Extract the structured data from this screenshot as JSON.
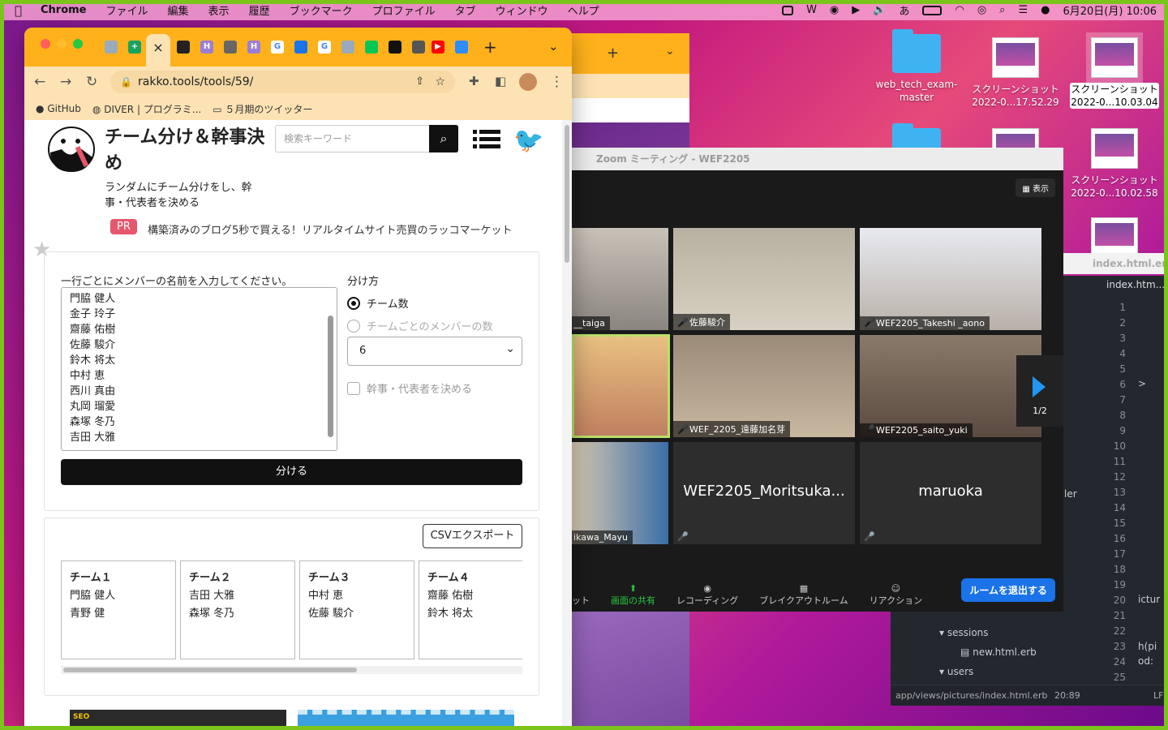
{
  "menubar": {
    "app": "Chrome",
    "items": [
      "ファイル",
      "編集",
      "表示",
      "履歴",
      "ブックマーク",
      "プロファイル",
      "タブ",
      "ウィンドウ",
      "ヘルプ"
    ],
    "ime": "あ",
    "datetime": "6月20日(月)  10:06"
  },
  "desktop": {
    "icons": [
      {
        "label": "web_tech_exam-master"
      },
      {
        "label": "スクリーンショット 2022-0...17.52.29"
      },
      {
        "label": "スクリーンショット 2022-0...10.03.04"
      },
      {
        "label": "スクリーンショット 2022-0...10.02.58"
      }
    ]
  },
  "browser": {
    "url": "rakko.tools/tools/59/",
    "active_tab_icon": "×",
    "bookmarks": [
      "GitHub",
      "DIVER | プログラミ...",
      "５月期のツイッター"
    ]
  },
  "page": {
    "title": "チーム分け＆幹事決め",
    "description": "ランダムにチーム分けをし、幹事・代表者を決める",
    "search_placeholder": "検索キーワード",
    "pr_badge": "PR",
    "pr_text": "構築済みのブログ5秒で買える！リアルタイムサイト売買のラッコマーケット",
    "members_label": "一行ごとにメンバーの名前を入力してください。",
    "members": [
      "門脇 健人",
      "金子 玲子",
      "齋藤 佑樹",
      "佐藤 駿介",
      "鈴木 将太",
      "中村 恵",
      "西川 真由",
      "丸岡 瑠愛",
      "森塚 冬乃",
      "吉田 大雅"
    ],
    "method_label": "分け方",
    "option_teams": "チーム数",
    "option_members": "チームごとのメンバーの数",
    "select_value": "6",
    "leader_checkbox": "幹事・代表者を決める",
    "submit": "分ける",
    "csv_button": "CSVエクスポート",
    "teams": [
      {
        "name": "チーム１",
        "members": [
          "門脇 健人",
          "青野 健"
        ]
      },
      {
        "name": "チーム２",
        "members": [
          "吉田 大雅",
          "森塚 冬乃"
        ]
      },
      {
        "name": "チーム３",
        "members": [
          "中村 恵",
          "佐藤 駿介"
        ]
      },
      {
        "name": "チーム４",
        "members": [
          "齋藤 佑樹",
          "鈴木 将太"
        ]
      }
    ],
    "ad_badge": "SEO"
  },
  "zoom": {
    "title": "Zoom ミーティング - WEF2205",
    "view_label": "表示",
    "participants": [
      "__taiga",
      "佐藤駿介",
      "WEF2205_Takeshi _aono",
      "WEF_2205_遠藤加名芽",
      "WEF2205_saito_yuki",
      "ikawa_Mayu",
      "WEF2205_Moritsuka...",
      "maruoka"
    ],
    "page_indicator": "1/2",
    "toolbar": [
      "ット",
      "画面の共有",
      "レコーディング",
      "ブレイクアウトルーム",
      "リアクション"
    ],
    "leave": "ルームを退出する"
  },
  "editor": {
    "tab": "index.htm...",
    "finder_file": "index.html.er",
    "tree": [
      "sessions",
      "new.html.erb",
      "users"
    ],
    "code_fragments": [
      ">",
      "ler",
      "ictur",
      "h(pi",
      "od:"
    ],
    "line_numbers": [
      "1",
      "2",
      "3",
      "4",
      "5",
      "6",
      "7",
      "8",
      "9",
      "10",
      "11",
      "12",
      "13",
      "14",
      "15",
      "16",
      "17",
      "18",
      "19",
      "20",
      "21",
      "22",
      "23",
      "24",
      "25"
    ],
    "status_path": "app/views/pictures/index.html.erb",
    "status_pos": "20:89",
    "status_eol": "LF"
  }
}
